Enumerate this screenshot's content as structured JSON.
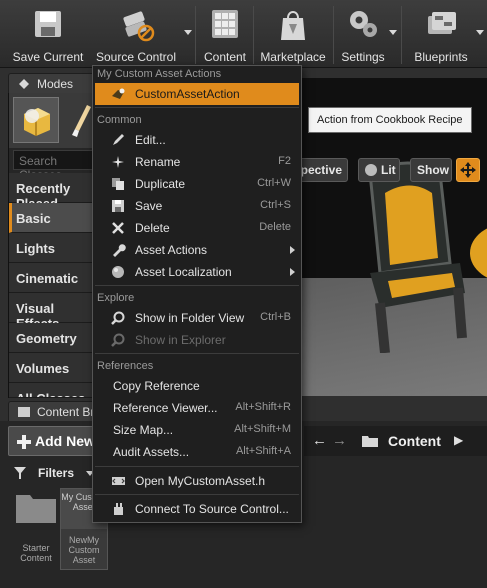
{
  "toolbar": {
    "items": [
      {
        "label": "Save Current",
        "icon": "floppy-disk-icon"
      },
      {
        "label": "Source Control",
        "icon": "source-control-icon"
      },
      {
        "label": "Content",
        "icon": "content-grid-icon"
      },
      {
        "label": "Marketplace",
        "icon": "marketplace-bag-icon"
      },
      {
        "label": "Settings",
        "icon": "gears-icon"
      },
      {
        "label": "Blueprints",
        "icon": "blueprints-icon"
      }
    ]
  },
  "modes": {
    "tab_label": "Modes",
    "search_placeholder": "Search Classes",
    "categories": [
      "Recently Placed",
      "Basic",
      "Lights",
      "Cinematic",
      "Visual Effects",
      "Geometry",
      "Volumes",
      "All Classes"
    ],
    "selected_category": "Basic"
  },
  "viewport": {
    "buttons": [
      "Perspective",
      "Lit",
      "Show"
    ]
  },
  "tooltip": {
    "text": "Action from Cookbook Recipe"
  },
  "content_browser": {
    "tab_label": "Content Browser",
    "add_new_label": "Add New",
    "filters_label": "Filters",
    "path_label": "Content",
    "assets": [
      {
        "label": "Starter Content",
        "thumb_label": ""
      },
      {
        "label": "NewMy Custom Asset",
        "thumb_label": "My Custom Asset"
      }
    ]
  },
  "context_menu": {
    "sections": [
      {
        "title": "My Custom Asset Actions",
        "items": [
          {
            "label": "CustomAssetAction",
            "shortcut": "",
            "icon": "custom-action-icon",
            "highlighted": true
          }
        ]
      },
      {
        "title": "Common",
        "items": [
          {
            "label": "Edit...",
            "shortcut": "",
            "icon": "edit-icon"
          },
          {
            "label": "Rename",
            "shortcut": "F2",
            "icon": "rename-icon"
          },
          {
            "label": "Duplicate",
            "shortcut": "Ctrl+W",
            "icon": "duplicate-icon"
          },
          {
            "label": "Save",
            "shortcut": "Ctrl+S",
            "icon": "save-icon"
          },
          {
            "label": "Delete",
            "shortcut": "Delete",
            "icon": "delete-icon"
          },
          {
            "label": "Asset Actions",
            "shortcut": "",
            "icon": "wrench-icon",
            "submenu": true
          },
          {
            "label": "Asset Localization",
            "shortcut": "",
            "icon": "globe-icon",
            "submenu": true
          }
        ]
      },
      {
        "title": "Explore",
        "items": [
          {
            "label": "Show in Folder View",
            "shortcut": "Ctrl+B",
            "icon": "magnifier-icon"
          },
          {
            "label": "Show in Explorer",
            "shortcut": "",
            "icon": "magnifier-icon",
            "disabled": true
          }
        ]
      },
      {
        "title": "References",
        "items": [
          {
            "label": "Copy Reference",
            "shortcut": ""
          },
          {
            "label": "Reference Viewer...",
            "shortcut": "Alt+Shift+R"
          },
          {
            "label": "Size Map...",
            "shortcut": "Alt+Shift+M"
          },
          {
            "label": "Audit Assets...",
            "shortcut": "Alt+Shift+A"
          }
        ]
      },
      {
        "title": "",
        "items": [
          {
            "label": "Open MyCustomAsset.h",
            "shortcut": "",
            "icon": "code-file-icon"
          }
        ]
      },
      {
        "title": "",
        "items": [
          {
            "label": "Connect To Source Control...",
            "shortcut": "",
            "icon": "source-control-connect-icon"
          }
        ]
      }
    ]
  },
  "colors": {
    "accent": "#e08b1c",
    "menu_bg": "#1f1f1f",
    "toolbar_bg": "#333333"
  }
}
